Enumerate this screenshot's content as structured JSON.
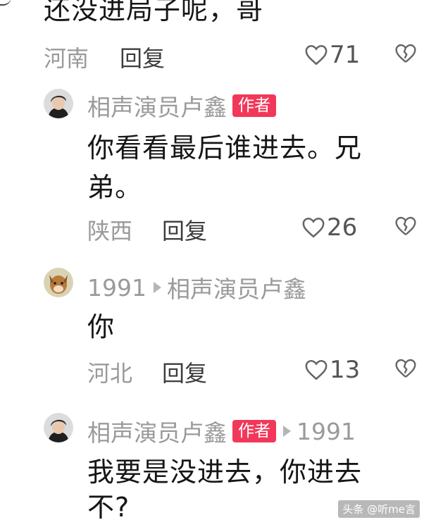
{
  "comments": [
    {
      "text": "还没进局子呢，哥",
      "location": "河南",
      "reply_label": "回复",
      "likes": "71"
    },
    {
      "username": "相声演员卢鑫",
      "badge": "作者",
      "text_line1": "你看看最后谁进去。兄",
      "text_line2": "弟。",
      "location": "陕西",
      "reply_label": "回复",
      "likes": "26"
    },
    {
      "username": "1991",
      "reply_to": "相声演员卢鑫",
      "text": "你",
      "location": "河北",
      "reply_label": "回复",
      "likes": "13"
    },
    {
      "username": "相声演员卢鑫",
      "badge": "作者",
      "reply_to": "1991",
      "text_line1": "我要是没进去，你进去",
      "text_line2": "不?"
    }
  ],
  "watermark": "头条 @听me言",
  "colors": {
    "badge": "#f2385a",
    "meta": "#9a9a9a",
    "text": "#161616"
  },
  "icons": [
    "heart-outline-icon",
    "broken-heart-icon",
    "reply-arrow-icon"
  ]
}
